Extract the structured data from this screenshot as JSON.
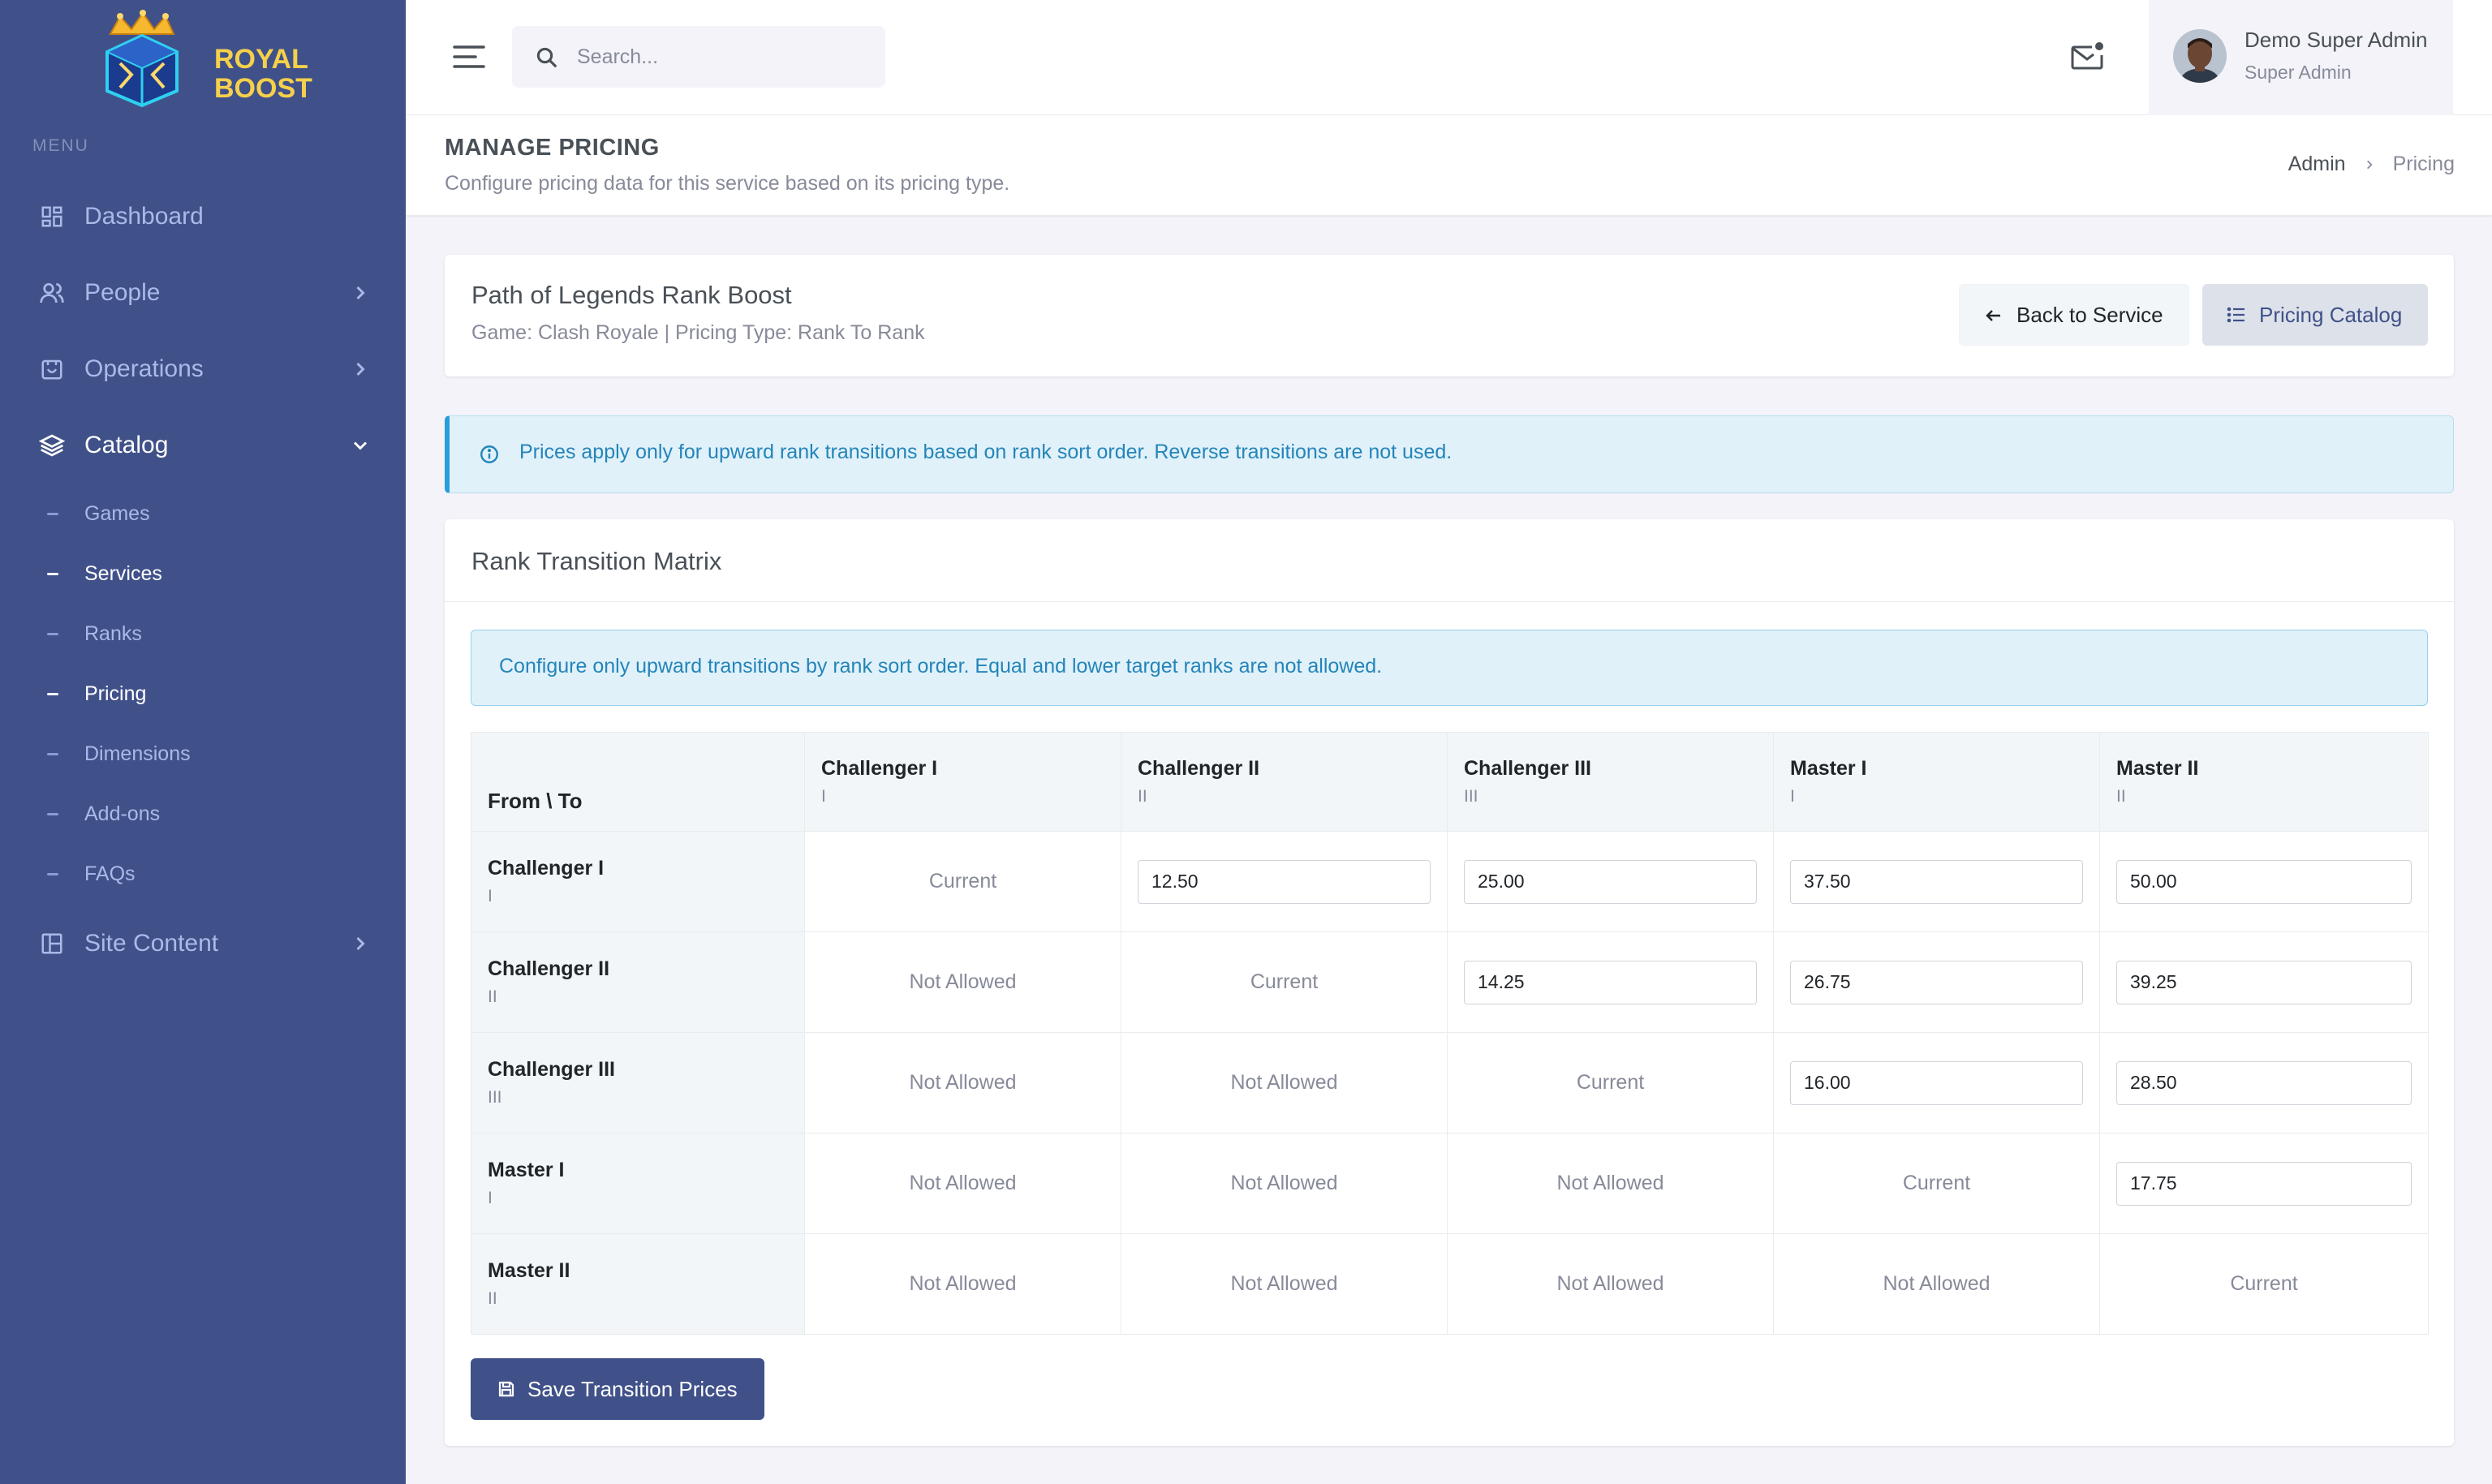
{
  "brand": {
    "line1": "ROYAL",
    "line2": "BOOST"
  },
  "sidebar": {
    "menu_title": "MENU",
    "items": [
      {
        "label": "Dashboard",
        "icon": "dashboard-icon"
      },
      {
        "label": "People",
        "icon": "people-icon"
      },
      {
        "label": "Operations",
        "icon": "operations-icon"
      },
      {
        "label": "Catalog",
        "icon": "layers-icon"
      },
      {
        "label": "Site Content",
        "icon": "layout-icon"
      }
    ],
    "catalog_sub": [
      {
        "label": "Games"
      },
      {
        "label": "Services"
      },
      {
        "label": "Ranks"
      },
      {
        "label": "Pricing"
      },
      {
        "label": "Dimensions"
      },
      {
        "label": "Add-ons"
      },
      {
        "label": "FAQs"
      }
    ]
  },
  "topbar": {
    "search_placeholder": "Search...",
    "user_name": "Demo Super Admin",
    "user_role": "Super Admin"
  },
  "page": {
    "title": "MANAGE PRICING",
    "subtitle": "Configure pricing data for this service based on its pricing type.",
    "breadcrumb": [
      "Admin",
      "Pricing"
    ]
  },
  "service": {
    "name": "Path of Legends Rank Boost",
    "meta": "Game: Clash Royale | Pricing Type: Rank To Rank",
    "back_label": "Back to Service",
    "catalog_label": "Pricing Catalog"
  },
  "alert_top": "Prices apply only for upward rank transitions based on rank sort order. Reverse transitions are not used.",
  "matrix": {
    "title": "Rank Transition Matrix",
    "info": "Configure only upward transitions by rank sort order. Equal and lower target ranks are not allowed.",
    "corner": "From \\ To",
    "columns": [
      {
        "name": "Challenger I",
        "code": "I"
      },
      {
        "name": "Challenger II",
        "code": "II"
      },
      {
        "name": "Challenger III",
        "code": "III"
      },
      {
        "name": "Master I",
        "code": "I"
      },
      {
        "name": "Master II",
        "code": "II"
      }
    ],
    "rows": [
      {
        "name": "Challenger I",
        "code": "I",
        "cells": [
          "Current",
          "12.50",
          "25.00",
          "37.50",
          "50.00"
        ]
      },
      {
        "name": "Challenger II",
        "code": "II",
        "cells": [
          "Not Allowed",
          "Current",
          "14.25",
          "26.75",
          "39.25"
        ]
      },
      {
        "name": "Challenger III",
        "code": "III",
        "cells": [
          "Not Allowed",
          "Not Allowed",
          "Current",
          "16.00",
          "28.50"
        ]
      },
      {
        "name": "Master I",
        "code": "I",
        "cells": [
          "Not Allowed",
          "Not Allowed",
          "Not Allowed",
          "Current",
          "17.75"
        ]
      },
      {
        "name": "Master II",
        "code": "II",
        "cells": [
          "Not Allowed",
          "Not Allowed",
          "Not Allowed",
          "Not Allowed",
          "Current"
        ]
      }
    ],
    "save_label": "Save Transition Prices"
  },
  "colors": {
    "sidebar_bg": "#405189",
    "primary": "#405189",
    "info_text": "#2385ba",
    "info_bg": "#e1f1f9"
  }
}
